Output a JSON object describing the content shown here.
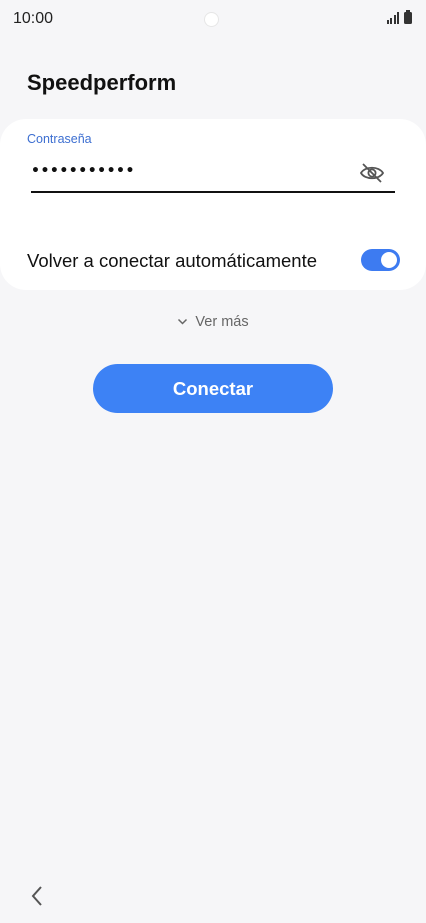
{
  "status_bar": {
    "time": "10:00"
  },
  "page": {
    "title": "Speedperform"
  },
  "password": {
    "label": "Contraseña",
    "value": "•••••••••••"
  },
  "reconnect": {
    "label": "Volver a conectar automáticamente",
    "enabled": true
  },
  "more": {
    "label": "Ver más"
  },
  "actions": {
    "connect_label": "Conectar"
  },
  "icons": {
    "visibility": "eye-off-icon",
    "expand": "chevron-down-icon",
    "back": "chevron-left-icon",
    "battery": "battery-icon",
    "signal": "signal-icon"
  },
  "colors": {
    "accent": "#3d82f5",
    "label_accent": "#3d6fd1",
    "background": "#f6f6f8",
    "card": "#ffffff"
  }
}
